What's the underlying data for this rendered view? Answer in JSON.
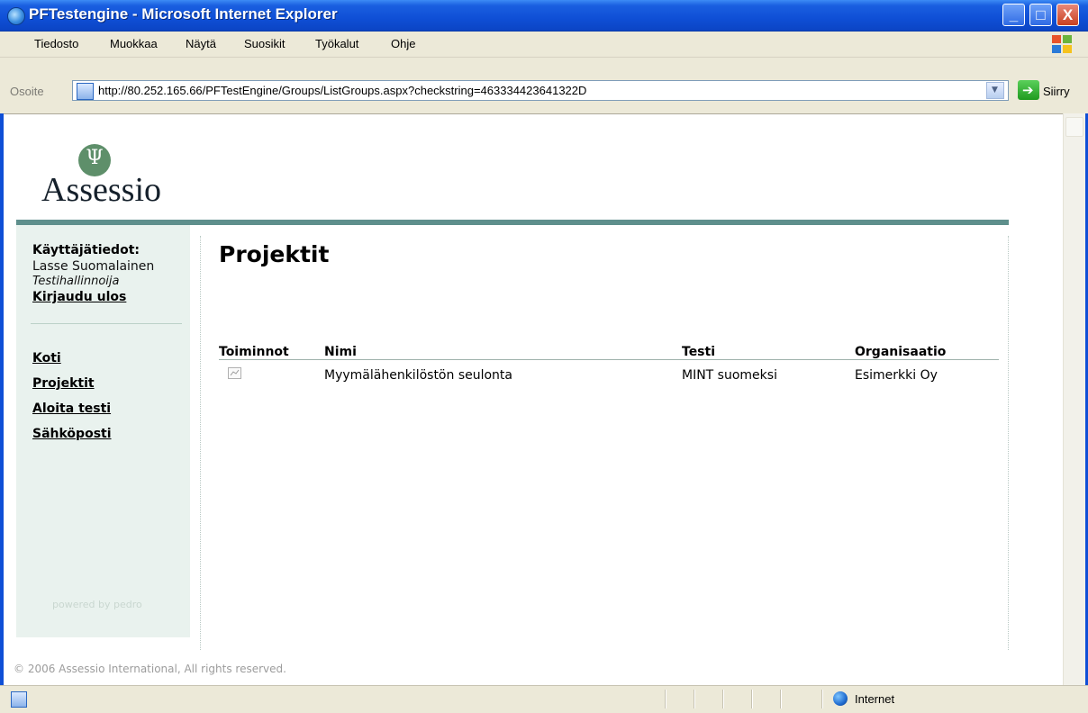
{
  "window": {
    "title": "PFTestengine - Microsoft Internet Explorer",
    "min_glyph": "_",
    "max_glyph": "□",
    "close_glyph": "X"
  },
  "menu": {
    "items": [
      "Tiedosto",
      "Muokkaa",
      "Näytä",
      "Suosikit",
      "Työkalut",
      "Ohje"
    ]
  },
  "address": {
    "label": "Osoite",
    "url": "http://80.252.165.66/PFTestEngine/Groups/ListGroups.aspx?checkstring=463334423641322D",
    "go_label": "Siirry"
  },
  "logo": {
    "symbol": "Ψ",
    "text": "Assessio"
  },
  "sidebar": {
    "heading": "Käyttäjätiedot:",
    "user_name": "Lasse Suomalainen",
    "role": "Testihallinnoija",
    "logout": "Kirjaudu ulos",
    "nav": [
      "Koti",
      "Projektit",
      "Aloita testi",
      "Sähköposti"
    ],
    "powered": "powered by pedro"
  },
  "main": {
    "title": "Projektit",
    "columns": [
      "Toiminnot",
      "Nimi",
      "Testi",
      "Organisaatio"
    ],
    "rows": [
      {
        "name": "Myymälähenkilöstön seulonta",
        "test": "MINT suomeksi",
        "org": "Esimerkki Oy"
      }
    ]
  },
  "footer": {
    "copyright": "© 2006 Assessio International, All rights reserved."
  },
  "status": {
    "zone": "Internet"
  },
  "colors": {
    "titlebar": "#0f4fd6",
    "accent_teal": "#5e8f8c",
    "sidebar_bg": "#e9f2ee"
  }
}
